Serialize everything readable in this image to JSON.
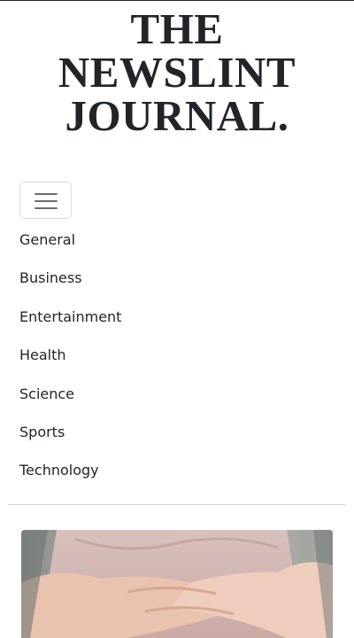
{
  "masthead": {
    "line1": "THE",
    "line2": "NEWSLINT",
    "line3": "JOURNAL."
  },
  "menu_toggle": {
    "icon": "hamburger-icon"
  },
  "nav": {
    "items": [
      {
        "label": "General"
      },
      {
        "label": "Business"
      },
      {
        "label": "Entertainment"
      },
      {
        "label": "Health"
      },
      {
        "label": "Science"
      },
      {
        "label": "Sports"
      },
      {
        "label": "Technology"
      }
    ]
  },
  "colors": {
    "text": "#212529",
    "divider": "#cfcfcf",
    "toggle_border": "#dcdcdc"
  }
}
